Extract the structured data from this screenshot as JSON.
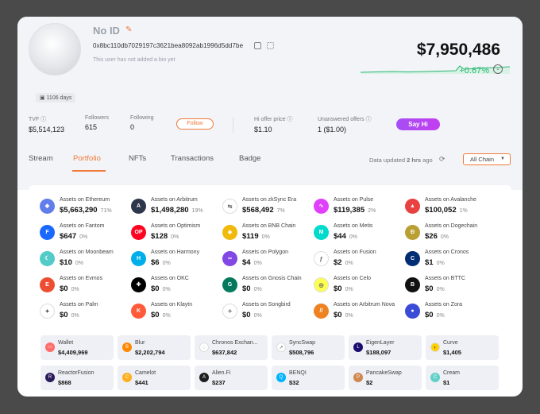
{
  "profile": {
    "name": "No ID",
    "address": "0x8bc110db7029197c3621bea8092ab1996d5dd7be",
    "bio": "This user has not added a bio yet",
    "days": "1106 days",
    "balance": "$7,950,486",
    "change": "+0.67%"
  },
  "stats": {
    "tvf_label": "TVF",
    "tvf_value": "$5,514,123",
    "followers_label": "Followers",
    "followers_value": "615",
    "following_label": "Following",
    "following_value": "0",
    "follow_button": "Follow",
    "hi_offer_label": "Hi offer price",
    "hi_offer_value": "$1.10",
    "unanswered_label": "Unanswered offers",
    "unanswered_value": "1 ($1.00)",
    "sayhi_button": "Say Hi"
  },
  "tabs": [
    "Stream",
    "Portfolio",
    "NFTs",
    "Transactions",
    "Badge"
  ],
  "active_tab": "Portfolio",
  "updated": {
    "prefix": "Data updated ",
    "time": "2 hrs",
    "suffix": " ago"
  },
  "chain_select": "All Chain",
  "assets": [
    {
      "name": "Assets on Ethereum",
      "value": "$5,663,290",
      "pct": "71%",
      "color": "#627eea",
      "glyph": "◆"
    },
    {
      "name": "Assets on Arbitrum",
      "value": "$1,498,280",
      "pct": "19%",
      "color": "#2d374b",
      "glyph": "A"
    },
    {
      "name": "Assets on zkSync Era",
      "value": "$568,492",
      "pct": "7%",
      "color": "#ffffff",
      "glyph": "⇆"
    },
    {
      "name": "Assets on Pulse",
      "value": "$119,385",
      "pct": "2%",
      "color": "#e040fb",
      "glyph": "∿"
    },
    {
      "name": "Assets on Avalanche",
      "value": "$100,052",
      "pct": "1%",
      "color": "#e84142",
      "glyph": "▲"
    },
    {
      "name": "Assets on Fantom",
      "value": "$647",
      "pct": "0%",
      "color": "#1969ff",
      "glyph": "F"
    },
    {
      "name": "Assets on Optimism",
      "value": "$128",
      "pct": "0%",
      "color": "#ff0420",
      "glyph": "OP"
    },
    {
      "name": "Assets on BNB Chain",
      "value": "$119",
      "pct": "0%",
      "color": "#f0b90b",
      "glyph": "◈"
    },
    {
      "name": "Assets on Metis",
      "value": "$44",
      "pct": "0%",
      "color": "#00dacc",
      "glyph": "M"
    },
    {
      "name": "Assets on Dogechain",
      "value": "$26",
      "pct": "0%",
      "color": "#ba9f33",
      "glyph": "Ð"
    },
    {
      "name": "Assets on Moonbeam",
      "value": "$10",
      "pct": "0%",
      "color": "#53cbc8",
      "glyph": "☾"
    },
    {
      "name": "Assets on Harmony",
      "value": "$6",
      "pct": "0%",
      "color": "#00aee9",
      "glyph": "H"
    },
    {
      "name": "Assets on Polygon",
      "value": "$4",
      "pct": "0%",
      "color": "#8247e5",
      "glyph": "∞"
    },
    {
      "name": "Assets on Fusion",
      "value": "$2",
      "pct": "0%",
      "color": "#ffffff",
      "glyph": "ƒ"
    },
    {
      "name": "Assets on Cronos",
      "value": "$1",
      "pct": "0%",
      "color": "#002d74",
      "glyph": "C"
    },
    {
      "name": "Assets on Evmos",
      "value": "$0",
      "pct": "0%",
      "color": "#ed4e33",
      "glyph": "E"
    },
    {
      "name": "Assets on OKC",
      "value": "$0",
      "pct": "0%",
      "color": "#000000",
      "glyph": "✚"
    },
    {
      "name": "Assets on Gnosis Chain",
      "value": "$0",
      "pct": "0%",
      "color": "#04795b",
      "glyph": "G"
    },
    {
      "name": "Assets on Celo",
      "value": "$0",
      "pct": "0%",
      "color": "#fcff52",
      "glyph": "◎"
    },
    {
      "name": "Assets on BTTC",
      "value": "$0",
      "pct": "0%",
      "color": "#111111",
      "glyph": "B"
    },
    {
      "name": "Assets on Palm",
      "value": "$0",
      "pct": "0%",
      "color": "#ffffff",
      "glyph": "✦"
    },
    {
      "name": "Assets on Klaytn",
      "value": "$0",
      "pct": "0%",
      "color": "#ff5b3a",
      "glyph": "K"
    },
    {
      "name": "Assets on Songbird",
      "value": "$0",
      "pct": "0%",
      "color": "#ffffff",
      "glyph": "✧"
    },
    {
      "name": "Assets on Arbitrum Nova",
      "value": "$0",
      "pct": "0%",
      "color": "#ef8220",
      "glyph": "//"
    },
    {
      "name": "Assets on Zora",
      "value": "$0",
      "pct": "0%",
      "color": "#3a4bd6",
      "glyph": "●"
    }
  ],
  "protocols": [
    {
      "name": "Wallet",
      "value": "$4,409,969",
      "color": "#ff6b6b",
      "glyph": "▭"
    },
    {
      "name": "Blur",
      "value": "$2,202,794",
      "color": "#ff8700",
      "glyph": "B"
    },
    {
      "name": "Chronos Exchan...",
      "value": "$637,842",
      "color": "#ffffff",
      "glyph": "◌"
    },
    {
      "name": "SyncSwap",
      "value": "$508,796",
      "color": "#ffffff",
      "glyph": "↗"
    },
    {
      "name": "EigenLayer",
      "value": "$188,097",
      "color": "#1a0c6d",
      "glyph": "L"
    },
    {
      "name": "Curve",
      "value": "$1,405",
      "color": "#ffd000",
      "glyph": "◐"
    },
    {
      "name": "ReactorFusion",
      "value": "$868",
      "color": "#2b1b5a",
      "glyph": "R"
    },
    {
      "name": "Camelot",
      "value": "$441",
      "color": "#ffaf1d",
      "glyph": "C"
    },
    {
      "name": "Alien.Fi",
      "value": "$237",
      "color": "#1e1e1e",
      "glyph": "A"
    },
    {
      "name": "BENQI",
      "value": "$32",
      "color": "#00b3ff",
      "glyph": "Q"
    },
    {
      "name": "PancakeSwap",
      "value": "$2",
      "color": "#d1884f",
      "glyph": "P"
    },
    {
      "name": "Cream",
      "value": "$1",
      "color": "#61d1c8",
      "glyph": "C"
    }
  ]
}
